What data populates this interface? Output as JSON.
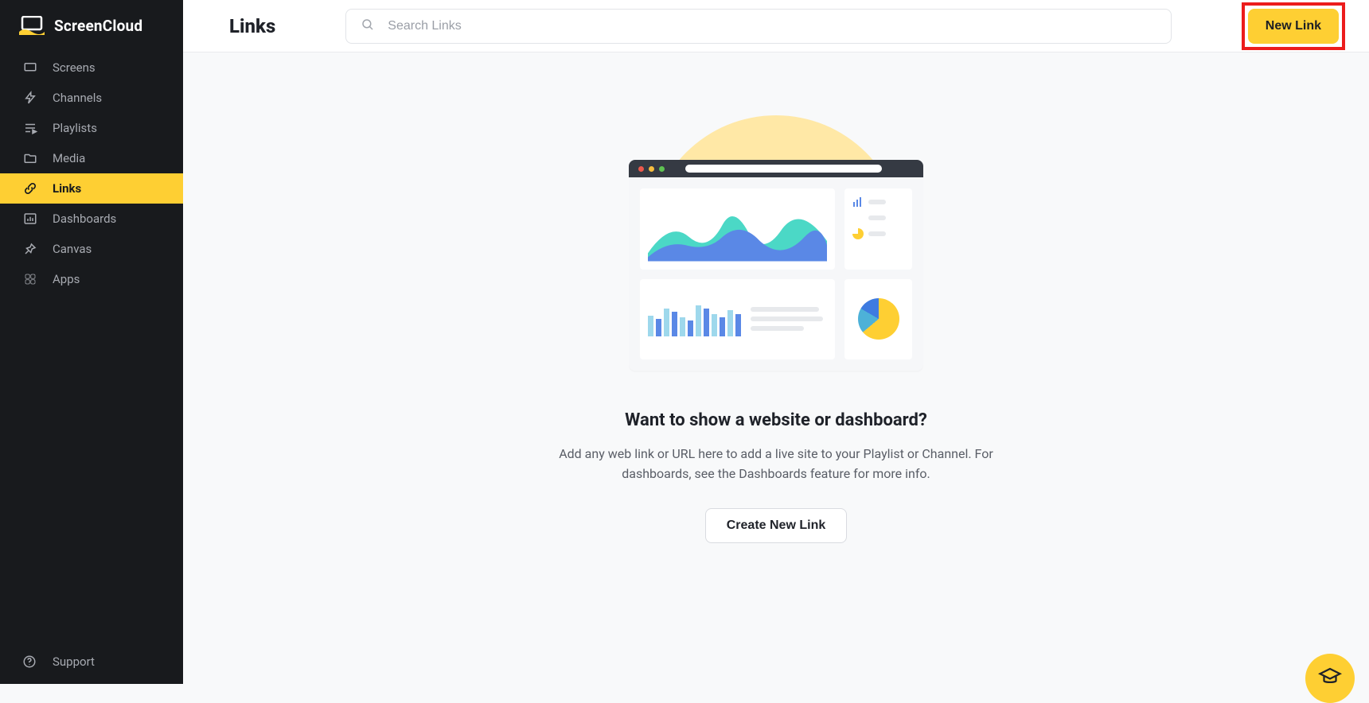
{
  "brand": "ScreenCloud",
  "sidebar": {
    "items": [
      {
        "label": "Screens",
        "icon": "screen-icon"
      },
      {
        "label": "Channels",
        "icon": "bolt-icon"
      },
      {
        "label": "Playlists",
        "icon": "playlist-icon"
      },
      {
        "label": "Media",
        "icon": "folder-icon"
      },
      {
        "label": "Links",
        "icon": "link-icon"
      },
      {
        "label": "Dashboards",
        "icon": "chart-icon"
      },
      {
        "label": "Canvas",
        "icon": "pin-icon"
      },
      {
        "label": "Apps",
        "icon": "apps-icon"
      }
    ],
    "active_index": 4,
    "support_label": "Support"
  },
  "header": {
    "page_title": "Links",
    "search_placeholder": "Search Links",
    "new_link_label": "New Link"
  },
  "empty_state": {
    "heading": "Want to show a website or dashboard?",
    "description": "Add any web link or URL here to add a live site to your Playlist or Channel. For dashboards, see the Dashboards feature for more info.",
    "create_button_label": "Create New Link"
  },
  "fab": {
    "icon": "graduation-cap-icon"
  }
}
